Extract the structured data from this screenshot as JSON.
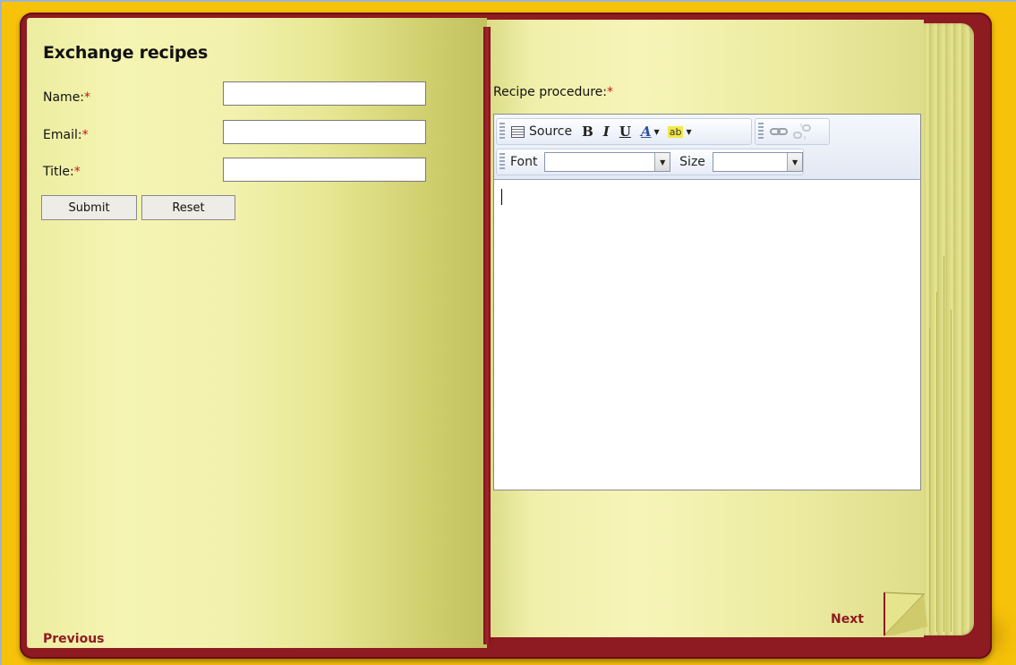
{
  "left_page": {
    "heading": "Exchange recipes",
    "fields": [
      {
        "label": "Name:",
        "required_mark": "*",
        "value": ""
      },
      {
        "label": "Email:",
        "required_mark": "*",
        "value": ""
      },
      {
        "label": "Title:",
        "required_mark": "*",
        "value": ""
      }
    ],
    "buttons": {
      "submit": "Submit",
      "reset": "Reset"
    },
    "previous_link": "Previous"
  },
  "right_page": {
    "procedure_label": "Recipe procedure:",
    "required_mark": "*",
    "editor": {
      "toolbar_row1": {
        "source_label": "Source",
        "bold": "B",
        "italic": "I",
        "underline": "U",
        "text_color_glyph": "A",
        "highlight_glyph": "ab"
      },
      "toolbar_row2": {
        "font_label": "Font",
        "font_value": "",
        "size_label": "Size",
        "size_value": ""
      },
      "content": ""
    },
    "next_link": "Next"
  },
  "colors": {
    "background": "#f7c20a",
    "cover": "#8e1b22",
    "page": "#f2f1ad",
    "link": "#8e1b22",
    "required": "#d01010"
  }
}
